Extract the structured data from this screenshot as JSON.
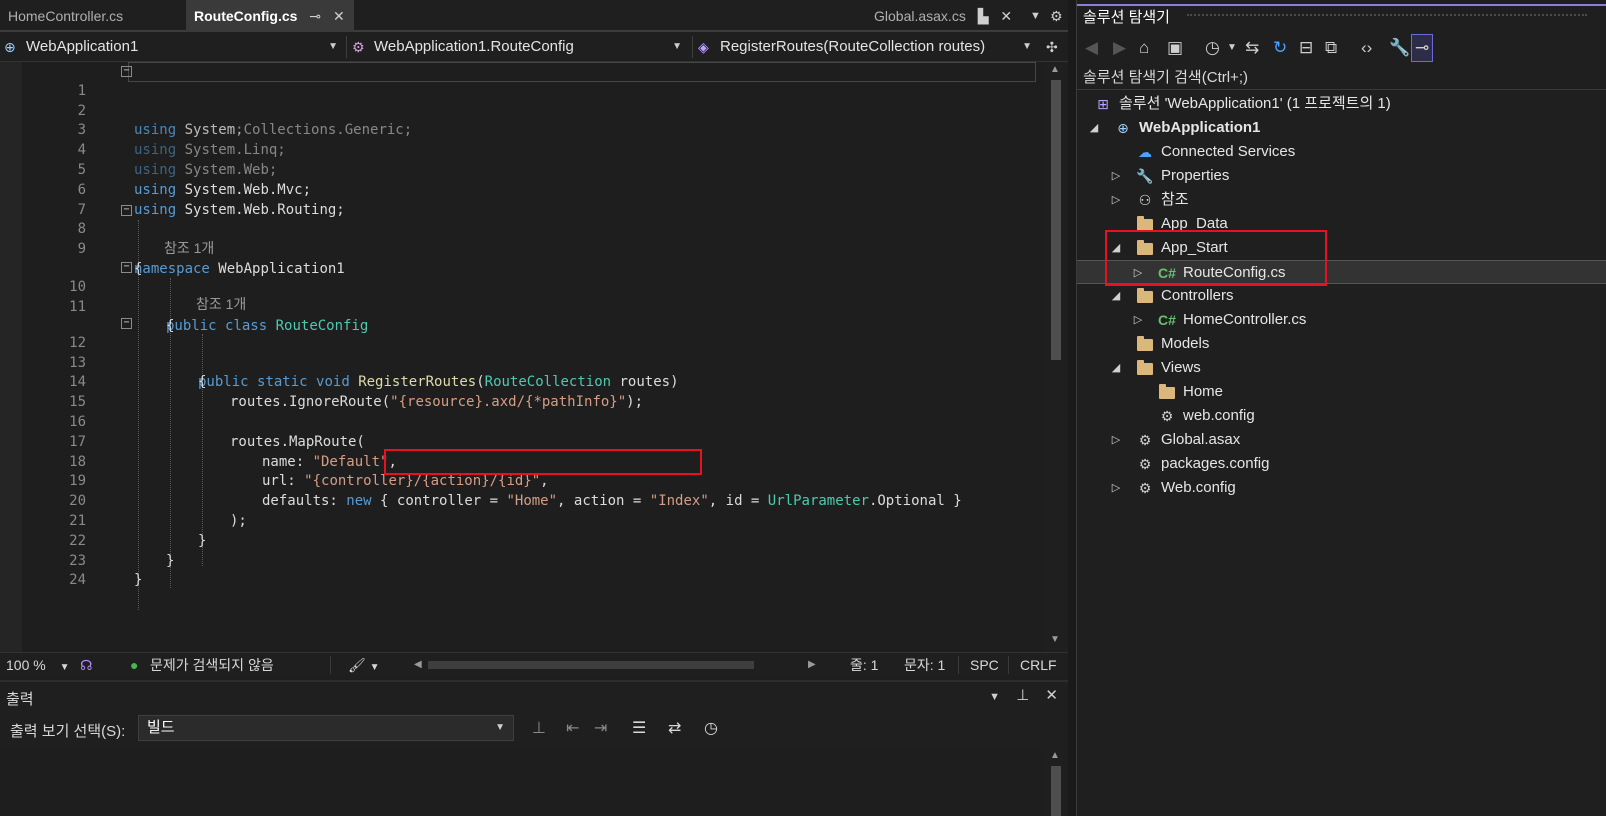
{
  "tabs": {
    "home_controller": "HomeController.cs",
    "route_config": "RouteConfig.cs",
    "global_asax": "Global.asax.cs"
  },
  "nav": {
    "project": "WebApplication1",
    "class": "WebApplication1.RouteConfig",
    "member": "RegisterRoutes(RouteCollection routes)"
  },
  "code": {
    "line_numbers": [
      "1",
      "2",
      "3",
      "4",
      "5",
      "6",
      "7",
      "8",
      "9",
      "10",
      "11",
      "12",
      "13",
      "14",
      "15",
      "16",
      "17",
      "18",
      "19",
      "20",
      "21",
      "22",
      "23",
      "24"
    ],
    "references_label": "참조 1개",
    "using": "using",
    "ns_system": "System;",
    "ns_generic": "System.Collections.Generic;",
    "ns_linq": "System.Linq;",
    "ns_web": "System.Web;",
    "ns_mvc": "System.Web.Mvc;",
    "ns_routing": "System.Web.Routing;",
    "kw_namespace": "namespace",
    "namespace_name": "WebApplication1",
    "brace_open": "{",
    "brace_close": "}",
    "kw_public": "public",
    "kw_class": "class",
    "class_name": "RouteConfig",
    "kw_static": "static",
    "kw_void": "void",
    "method_name": "RegisterRoutes",
    "paren_open": "(",
    "param_type": "RouteCollection",
    "param_name": " routes)",
    "ignore_call": "routes.IgnoreRoute(",
    "ignore_str": "\"{resource}.axd/{*pathInfo}\"",
    "ignore_end": ");",
    "maproute": "routes.MapRoute(",
    "name_key": "name: ",
    "name_val": "\"Default\"",
    "comma": ",",
    "url_key": "url: ",
    "url_val": "\"{controller}/{action}/{id}\"",
    "defaults_key": "defaults: ",
    "kw_new": "new",
    "defaults_open": " { ",
    "controller_key": "controller = ",
    "controller_val": "\"Home\"",
    "action_key": ", action = ",
    "action_val": "\"Index\"",
    "id_key": ", id = ",
    "urlparam_type": "UrlParameter",
    "optional": ".Optional }",
    "call_close": ");"
  },
  "status": {
    "zoom": "100 %",
    "problems": "문제가 검색되지 않음",
    "line": "줄: 1",
    "char": "문자: 1",
    "spc": "SPC",
    "crlf": "CRLF"
  },
  "output": {
    "title": "출력",
    "show_label": "출력 보기 선택(S):",
    "selected_source": "빌드"
  },
  "solution_explorer": {
    "title": "솔루션 탐색기",
    "search": "솔루션 탐색기 검색(Ctrl+;)",
    "solution": "솔루션 'WebApplication1' (1 프로젝트의 1)",
    "project": "WebApplication1",
    "items": {
      "connected_services": "Connected Services",
      "properties": "Properties",
      "references": "참조",
      "app_data": "App_Data",
      "app_start": "App_Start",
      "route_config": "RouteConfig.cs",
      "controllers": "Controllers",
      "home_controller": "HomeController.cs",
      "models": "Models",
      "views": "Views",
      "home": "Home",
      "views_web_config": "web.config",
      "global_asax": "Global.asax",
      "packages_config": "packages.config",
      "web_config": "Web.config"
    },
    "cs_badge": "C#"
  },
  "colors": {
    "highlight": "#e81123",
    "keyword": "#569cd6",
    "type": "#4ec9b0",
    "string": "#d69d85",
    "folder": "#dcb67a",
    "accent": "#8c7dd8"
  }
}
